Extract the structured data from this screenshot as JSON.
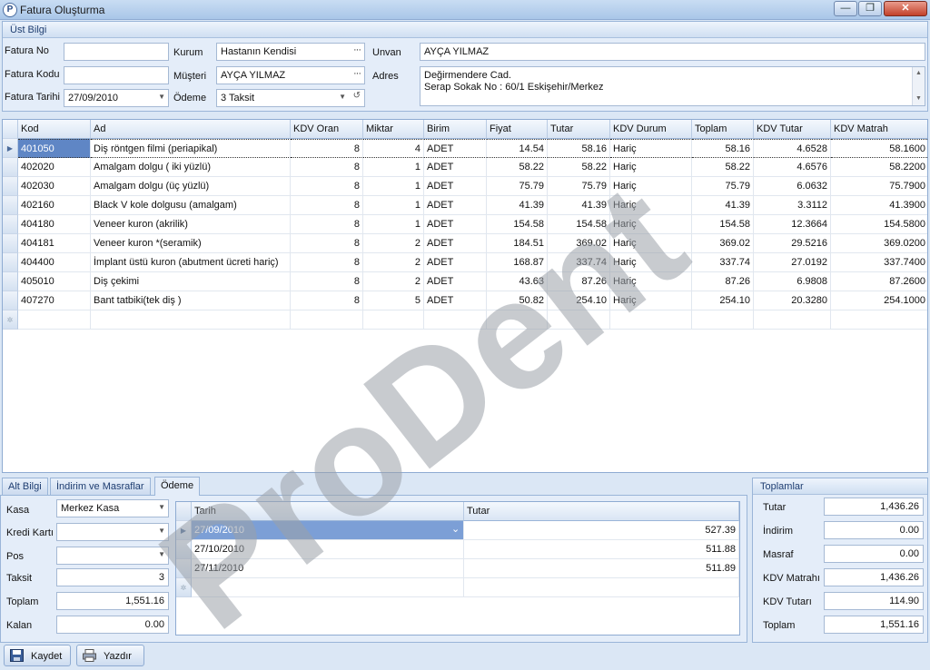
{
  "window": {
    "title": "Fatura Oluşturma",
    "minimize": "—",
    "restore": "❐",
    "close": "✕",
    "app_icon": "P"
  },
  "upper": {
    "title": "Üst Bilgi",
    "fatura_no_label": "Fatura No",
    "fatura_no_value": "",
    "fatura_kodu_label": "Fatura Kodu",
    "fatura_kodu_value": "",
    "fatura_tarihi_label": "Fatura Tarihi",
    "fatura_tarihi_value": "27/09/2010",
    "kurum_label": "Kurum",
    "kurum_value": "Hastanın Kendisi",
    "musteri_label": "Müşteri",
    "musteri_value": "AYÇA YILMAZ",
    "odeme_label": "Ödeme",
    "odeme_value": "3 Taksit",
    "unvan_label": "Unvan",
    "unvan_value": "AYÇA YILMAZ",
    "adres_label": "Adres",
    "adres_line1": "Değirmendere Cad.",
    "adres_line2": "Serap Sokak No : 60/1 Eskişehir/Merkez"
  },
  "grid": {
    "columns": [
      "Kod",
      "Ad",
      "KDV Oran",
      "Miktar",
      "Birim",
      "Fiyat",
      "Tutar",
      "KDV Durum",
      "Toplam",
      "KDV Tutar",
      "KDV Matrah"
    ],
    "rows": [
      [
        "401050",
        "Diş röntgen filmi (periapikal)",
        "8",
        "4",
        "ADET",
        "14.54",
        "58.16",
        "Hariç",
        "58.16",
        "4.6528",
        "58.1600"
      ],
      [
        "402020",
        "Amalgam dolgu ( iki yüzlü)",
        "8",
        "1",
        "ADET",
        "58.22",
        "58.22",
        "Hariç",
        "58.22",
        "4.6576",
        "58.2200"
      ],
      [
        "402030",
        "Amalgam dolgu (üç yüzlü)",
        "8",
        "1",
        "ADET",
        "75.79",
        "75.79",
        "Hariç",
        "75.79",
        "6.0632",
        "75.7900"
      ],
      [
        "402160",
        "Black V kole dolgusu (amalgam)",
        "8",
        "1",
        "ADET",
        "41.39",
        "41.39",
        "Hariç",
        "41.39",
        "3.3112",
        "41.3900"
      ],
      [
        "404180",
        "Veneer kuron (akrilik)",
        "8",
        "1",
        "ADET",
        "154.58",
        "154.58",
        "Hariç",
        "154.58",
        "12.3664",
        "154.5800"
      ],
      [
        "404181",
        "Veneer kuron *(seramik)",
        "8",
        "2",
        "ADET",
        "184.51",
        "369.02",
        "Hariç",
        "369.02",
        "29.5216",
        "369.0200"
      ],
      [
        "404400",
        "İmplant üstü kuron (abutment ücreti hariç)",
        "8",
        "2",
        "ADET",
        "168.87",
        "337.74",
        "Hariç",
        "337.74",
        "27.0192",
        "337.7400"
      ],
      [
        "405010",
        "Diş çekimi",
        "8",
        "2",
        "ADET",
        "43.63",
        "87.26",
        "Hariç",
        "87.26",
        "6.9808",
        "87.2600"
      ],
      [
        "407270",
        "Bant tatbiki(tek diş )",
        "8",
        "5",
        "ADET",
        "50.82",
        "254.10",
        "Hariç",
        "254.10",
        "20.3280",
        "254.1000"
      ]
    ]
  },
  "tabs": [
    "Alt Bilgi",
    "İndirim ve Masraflar",
    "Ödeme"
  ],
  "payment": {
    "kasa_label": "Kasa",
    "kasa_value": "Merkez Kasa",
    "kredi_label": "Kredi Kartı",
    "kredi_value": "",
    "pos_label": "Pos",
    "pos_value": "",
    "taksit_label": "Taksit",
    "taksit_value": "3",
    "toplam_label": "Toplam",
    "toplam_value": "1,551.16",
    "kalan_label": "Kalan",
    "kalan_value": "0.00",
    "columns": [
      "Tarih",
      "Tutar"
    ],
    "rows": [
      [
        "27/09/2010",
        "527.39"
      ],
      [
        "27/10/2010",
        "511.88"
      ],
      [
        "27/11/2010",
        "511.89"
      ]
    ]
  },
  "totals": {
    "title": "Toplamlar",
    "items": [
      {
        "label": "Tutar",
        "value": "1,436.26"
      },
      {
        "label": "İndirim",
        "value": "0.00"
      },
      {
        "label": "Masraf",
        "value": "0.00"
      },
      {
        "label": "KDV Matrahı",
        "value": "1,436.26"
      },
      {
        "label": "KDV Tutarı",
        "value": "114.90"
      },
      {
        "label": "Toplam",
        "value": "1,551.16"
      }
    ]
  },
  "buttons": {
    "save": "Kaydet",
    "print": "Yazdır"
  },
  "watermark": "ProDent",
  "colors": {
    "selection": "#5f86c5",
    "watermark": "#9aa0a8"
  }
}
